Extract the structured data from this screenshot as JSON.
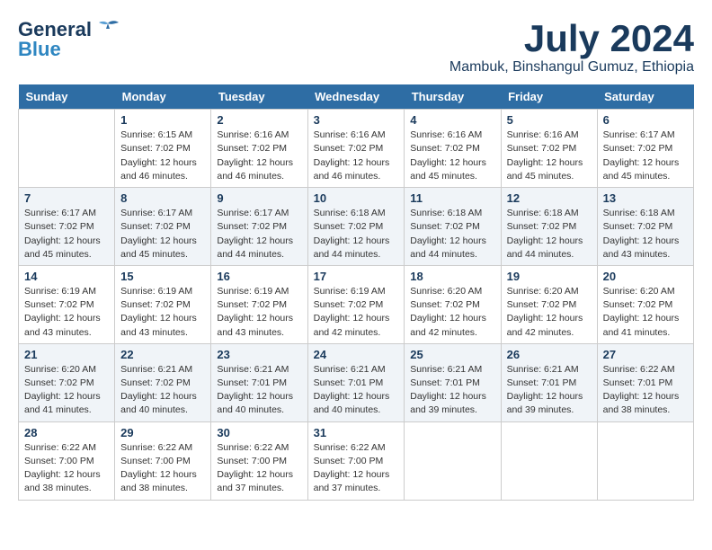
{
  "header": {
    "logo_line1": "General",
    "logo_line2": "Blue",
    "month": "July 2024",
    "location": "Mambuk, Binshangul Gumuz, Ethiopia"
  },
  "weekdays": [
    "Sunday",
    "Monday",
    "Tuesday",
    "Wednesday",
    "Thursday",
    "Friday",
    "Saturday"
  ],
  "weeks": [
    [
      {
        "day": "",
        "info": ""
      },
      {
        "day": "1",
        "info": "Sunrise: 6:15 AM\nSunset: 7:02 PM\nDaylight: 12 hours\nand 46 minutes."
      },
      {
        "day": "2",
        "info": "Sunrise: 6:16 AM\nSunset: 7:02 PM\nDaylight: 12 hours\nand 46 minutes."
      },
      {
        "day": "3",
        "info": "Sunrise: 6:16 AM\nSunset: 7:02 PM\nDaylight: 12 hours\nand 46 minutes."
      },
      {
        "day": "4",
        "info": "Sunrise: 6:16 AM\nSunset: 7:02 PM\nDaylight: 12 hours\nand 45 minutes."
      },
      {
        "day": "5",
        "info": "Sunrise: 6:16 AM\nSunset: 7:02 PM\nDaylight: 12 hours\nand 45 minutes."
      },
      {
        "day": "6",
        "info": "Sunrise: 6:17 AM\nSunset: 7:02 PM\nDaylight: 12 hours\nand 45 minutes."
      }
    ],
    [
      {
        "day": "7",
        "info": "Sunrise: 6:17 AM\nSunset: 7:02 PM\nDaylight: 12 hours\nand 45 minutes."
      },
      {
        "day": "8",
        "info": "Sunrise: 6:17 AM\nSunset: 7:02 PM\nDaylight: 12 hours\nand 45 minutes."
      },
      {
        "day": "9",
        "info": "Sunrise: 6:17 AM\nSunset: 7:02 PM\nDaylight: 12 hours\nand 44 minutes."
      },
      {
        "day": "10",
        "info": "Sunrise: 6:18 AM\nSunset: 7:02 PM\nDaylight: 12 hours\nand 44 minutes."
      },
      {
        "day": "11",
        "info": "Sunrise: 6:18 AM\nSunset: 7:02 PM\nDaylight: 12 hours\nand 44 minutes."
      },
      {
        "day": "12",
        "info": "Sunrise: 6:18 AM\nSunset: 7:02 PM\nDaylight: 12 hours\nand 44 minutes."
      },
      {
        "day": "13",
        "info": "Sunrise: 6:18 AM\nSunset: 7:02 PM\nDaylight: 12 hours\nand 43 minutes."
      }
    ],
    [
      {
        "day": "14",
        "info": "Sunrise: 6:19 AM\nSunset: 7:02 PM\nDaylight: 12 hours\nand 43 minutes."
      },
      {
        "day": "15",
        "info": "Sunrise: 6:19 AM\nSunset: 7:02 PM\nDaylight: 12 hours\nand 43 minutes."
      },
      {
        "day": "16",
        "info": "Sunrise: 6:19 AM\nSunset: 7:02 PM\nDaylight: 12 hours\nand 43 minutes."
      },
      {
        "day": "17",
        "info": "Sunrise: 6:19 AM\nSunset: 7:02 PM\nDaylight: 12 hours\nand 42 minutes."
      },
      {
        "day": "18",
        "info": "Sunrise: 6:20 AM\nSunset: 7:02 PM\nDaylight: 12 hours\nand 42 minutes."
      },
      {
        "day": "19",
        "info": "Sunrise: 6:20 AM\nSunset: 7:02 PM\nDaylight: 12 hours\nand 42 minutes."
      },
      {
        "day": "20",
        "info": "Sunrise: 6:20 AM\nSunset: 7:02 PM\nDaylight: 12 hours\nand 41 minutes."
      }
    ],
    [
      {
        "day": "21",
        "info": "Sunrise: 6:20 AM\nSunset: 7:02 PM\nDaylight: 12 hours\nand 41 minutes."
      },
      {
        "day": "22",
        "info": "Sunrise: 6:21 AM\nSunset: 7:02 PM\nDaylight: 12 hours\nand 40 minutes."
      },
      {
        "day": "23",
        "info": "Sunrise: 6:21 AM\nSunset: 7:01 PM\nDaylight: 12 hours\nand 40 minutes."
      },
      {
        "day": "24",
        "info": "Sunrise: 6:21 AM\nSunset: 7:01 PM\nDaylight: 12 hours\nand 40 minutes."
      },
      {
        "day": "25",
        "info": "Sunrise: 6:21 AM\nSunset: 7:01 PM\nDaylight: 12 hours\nand 39 minutes."
      },
      {
        "day": "26",
        "info": "Sunrise: 6:21 AM\nSunset: 7:01 PM\nDaylight: 12 hours\nand 39 minutes."
      },
      {
        "day": "27",
        "info": "Sunrise: 6:22 AM\nSunset: 7:01 PM\nDaylight: 12 hours\nand 38 minutes."
      }
    ],
    [
      {
        "day": "28",
        "info": "Sunrise: 6:22 AM\nSunset: 7:00 PM\nDaylight: 12 hours\nand 38 minutes."
      },
      {
        "day": "29",
        "info": "Sunrise: 6:22 AM\nSunset: 7:00 PM\nDaylight: 12 hours\nand 38 minutes."
      },
      {
        "day": "30",
        "info": "Sunrise: 6:22 AM\nSunset: 7:00 PM\nDaylight: 12 hours\nand 37 minutes."
      },
      {
        "day": "31",
        "info": "Sunrise: 6:22 AM\nSunset: 7:00 PM\nDaylight: 12 hours\nand 37 minutes."
      },
      {
        "day": "",
        "info": ""
      },
      {
        "day": "",
        "info": ""
      },
      {
        "day": "",
        "info": ""
      }
    ]
  ]
}
